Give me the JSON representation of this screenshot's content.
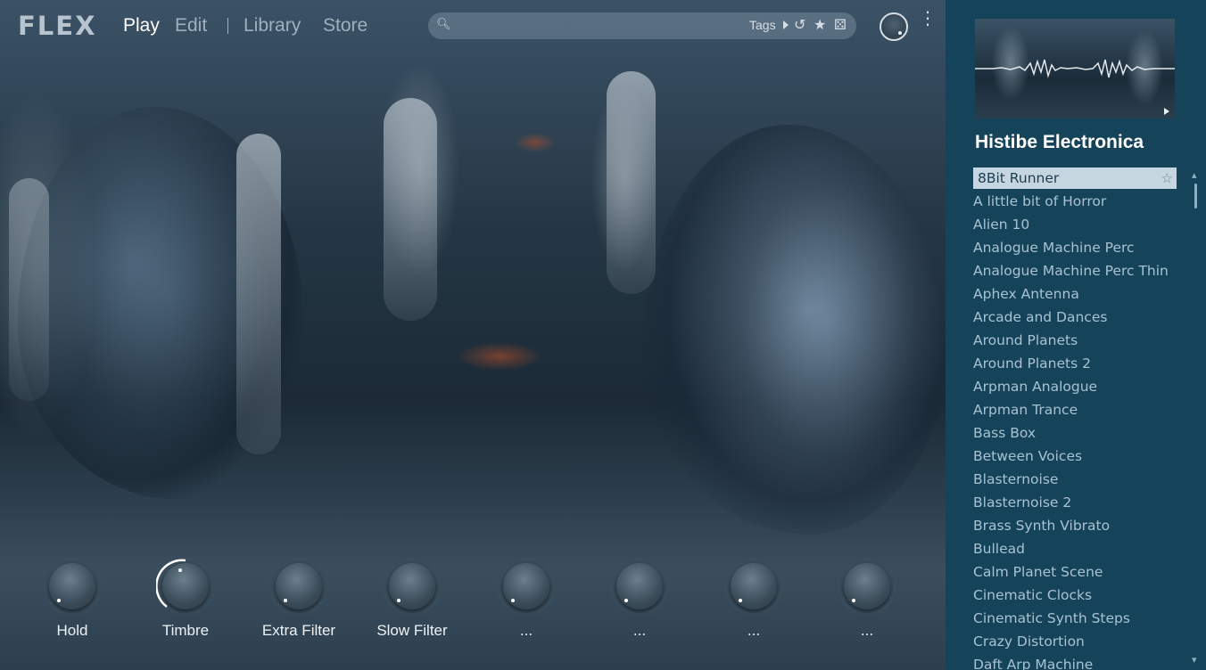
{
  "app": {
    "logo": "FLEX",
    "nav": [
      {
        "label": "Play",
        "active": true
      },
      {
        "label": "Edit",
        "active": false
      },
      {
        "label": "Library",
        "active": false
      },
      {
        "label": "Store",
        "active": false
      }
    ]
  },
  "search": {
    "placeholder": "",
    "value": "",
    "tags_label": "Tags",
    "icons": [
      "search-icon",
      "history-icon",
      "star-icon",
      "dice-icon"
    ]
  },
  "knobs": [
    {
      "label": "Hold"
    },
    {
      "label": "Timbre"
    },
    {
      "label": "Extra Filter"
    },
    {
      "label": "Slow Filter"
    },
    {
      "label": "..."
    },
    {
      "label": "..."
    },
    {
      "label": "..."
    },
    {
      "label": "..."
    }
  ],
  "panel": {
    "pack_title": "Histibe Electronica",
    "presets": [
      "8Bit Runner",
      "A little bit of Horror",
      "Alien 10",
      "Analogue Machine Perc",
      "Analogue Machine Perc Thin",
      "Aphex Antenna",
      "Arcade and Dances",
      "Around Planets",
      "Around Planets 2",
      "Arpman Analogue",
      "Arpman Trance",
      "Bass Box",
      "Between Voices",
      "Blasternoise",
      "Blasternoise 2",
      "Brass Synth Vibrato",
      "Bullead",
      "Calm Planet Scene",
      "Cinematic Clocks",
      "Cinematic Synth Steps",
      "Crazy Distortion",
      "Daft Arp Machine"
    ],
    "selected_index": 0
  },
  "colors": {
    "panel_bg": "#154359",
    "selected_bg": "#c6d6e0",
    "list_text": "#a9c2d2"
  }
}
